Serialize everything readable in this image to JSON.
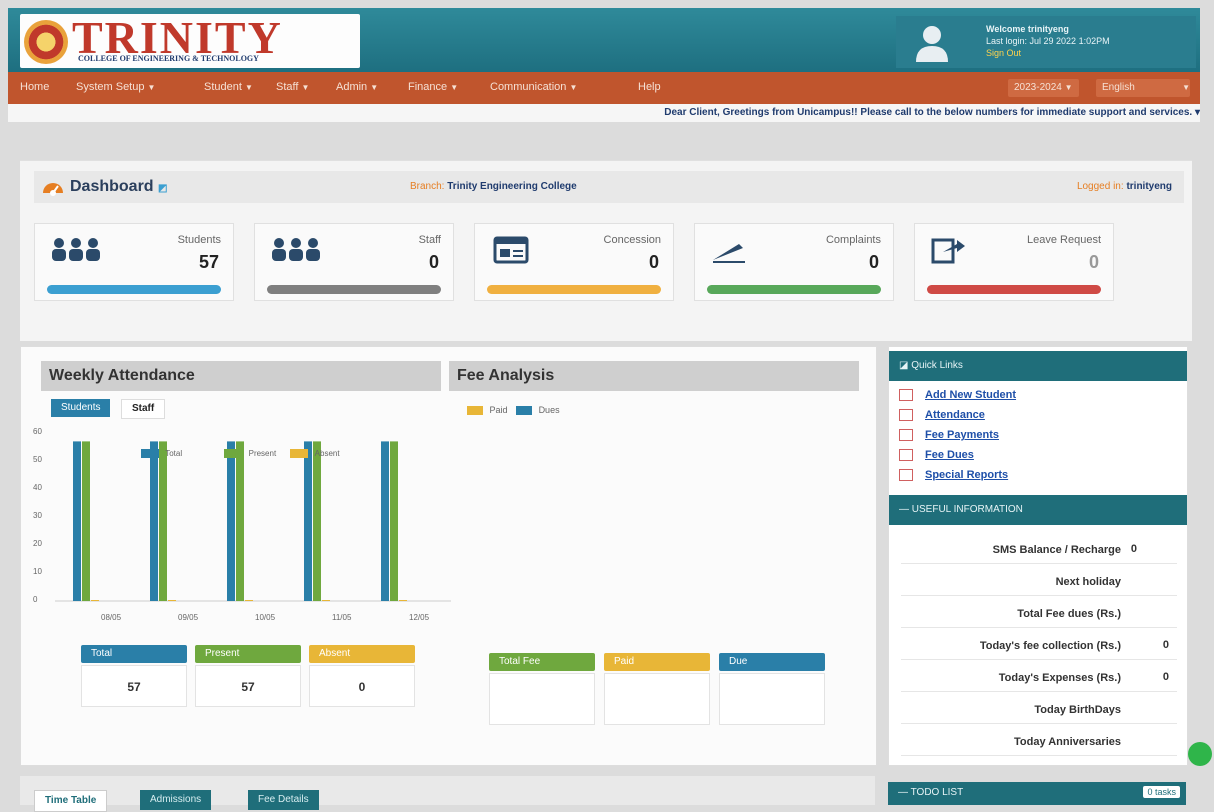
{
  "header": {
    "logo_word": "TRINITY",
    "logo_subtitle": "COLLEGE OF ENGINEERING & TECHNOLOGY",
    "user": {
      "welcome": "Welcome trinityeng",
      "last_login": "Last login: Jul 29 2022 1:02PM",
      "sign_out": "Sign Out"
    }
  },
  "nav": {
    "items": [
      {
        "label": "Home",
        "dropdown": false
      },
      {
        "label": "System Setup",
        "dropdown": true
      },
      {
        "label": "Student",
        "dropdown": true
      },
      {
        "label": "Staff",
        "dropdown": true
      },
      {
        "label": "Admin",
        "dropdown": true
      },
      {
        "label": "Finance",
        "dropdown": true
      },
      {
        "label": "Communication",
        "dropdown": true
      },
      {
        "label": "Help",
        "dropdown": false
      }
    ],
    "year": "2023-2024",
    "language": "English"
  },
  "marquee": "Dear Client, Greetings from Unicampus!! Please call to the below numbers for immediate support and services.",
  "dashboard": {
    "title": "Dashboard",
    "branch_label": "Branch:",
    "branch_value": "Trinity Engineering College",
    "logged_in_label": "Logged in:",
    "logged_in_value": "trinityeng",
    "stats": [
      {
        "label": "Students",
        "value": "57",
        "color": "#3b9fd1",
        "icon": "users-icon"
      },
      {
        "label": "Staff",
        "value": "0",
        "color": "#7f7f7f",
        "icon": "users-icon"
      },
      {
        "label": "Concession",
        "value": "0",
        "color": "#f0b040",
        "icon": "id-card-icon"
      },
      {
        "label": "Complaints",
        "value": "0",
        "color": "#58a85a",
        "icon": "pen-icon"
      },
      {
        "label": "Leave Request",
        "value": "0",
        "color": "#cf4a45",
        "icon": "export-icon"
      }
    ]
  },
  "attendance": {
    "title": "Weekly Attendance",
    "tabs": [
      "Students",
      "Staff"
    ],
    "legend": [
      "Total",
      "Present",
      "Absent"
    ],
    "summary": [
      {
        "label": "Total",
        "value": "57",
        "color": "#2a7fa8"
      },
      {
        "label": "Present",
        "value": "57",
        "color": "#6fa83e"
      },
      {
        "label": "Absent",
        "value": "0",
        "color": "#e8b637"
      }
    ]
  },
  "chart_data": {
    "type": "bar",
    "categories": [
      "08/05",
      "09/05",
      "10/05",
      "11/05",
      "12/05"
    ],
    "series": [
      {
        "name": "Total",
        "values": [
          57,
          57,
          57,
          57,
          57
        ],
        "color": "#2a7fa8"
      },
      {
        "name": "Present",
        "values": [
          57,
          57,
          57,
          57,
          57
        ],
        "color": "#6fa83e"
      },
      {
        "name": "Absent",
        "values": [
          0,
          0,
          0,
          0,
          0
        ],
        "color": "#e8b637"
      }
    ],
    "yticks": [
      "60",
      "50",
      "40",
      "30",
      "20",
      "10",
      "0"
    ],
    "ylim": [
      0,
      60
    ]
  },
  "fee": {
    "title": "Fee Analysis",
    "legend": [
      "Paid",
      "Dues"
    ],
    "summary": [
      {
        "label": "Total Fee",
        "color": "#6fa83e"
      },
      {
        "label": "Paid",
        "color": "#e8b637"
      },
      {
        "label": "Due",
        "color": "#2a7fa8"
      }
    ]
  },
  "quick_links": {
    "title": "Quick Links",
    "items": [
      "Add New Student",
      "Attendance",
      "Fee Payments",
      "Fee Dues",
      "Special Reports"
    ]
  },
  "useful_info": {
    "title": "USEFUL INFORMATION",
    "rows": [
      {
        "label": "SMS Balance / Recharge",
        "value": "0"
      },
      {
        "label": "Next holiday",
        "value": ""
      },
      {
        "label": "Total Fee dues (Rs.)",
        "value": ""
      },
      {
        "label": "Today's fee collection (Rs.)",
        "value": "0"
      },
      {
        "label": "Today's Expenses (Rs.)",
        "value": "0"
      },
      {
        "label": "Today BirthDays",
        "value": ""
      },
      {
        "label": "Today Anniversaries",
        "value": ""
      }
    ]
  },
  "bottom": {
    "tabs": [
      "Time Table",
      "Admissions",
      "Fee Details"
    ],
    "todo_title": "TODO LIST",
    "todo_badge": "0 tasks"
  }
}
